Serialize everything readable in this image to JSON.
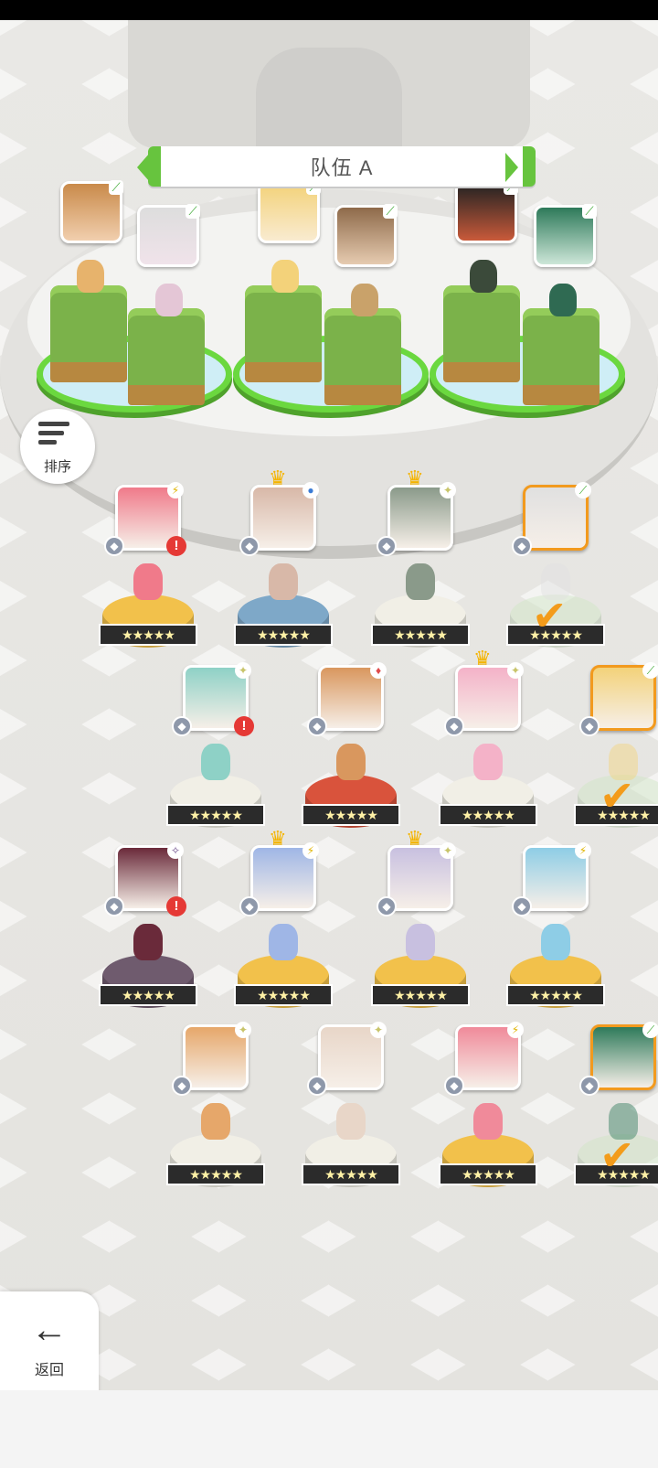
{
  "team": {
    "title": "队伍 A"
  },
  "sort": {
    "label": "排序",
    "icon": "sort-lines-icon"
  },
  "back": {
    "label": "返回",
    "icon": "arrow-left-icon"
  },
  "colors": {
    "accent_green": "#67c43e",
    "selected_orange": "#f29a1e",
    "alert_red": "#e53935",
    "crown_gold": "#f4b400"
  },
  "team_slots": [
    {
      "slot": 1,
      "element_icon": "leaf-icon"
    },
    {
      "slot": 2,
      "element_icon": "leaf-icon"
    },
    {
      "slot": 3,
      "element_icon": "leaf-icon"
    },
    {
      "slot": 4,
      "element_icon": "leaf-icon"
    },
    {
      "slot": 5,
      "element_icon": "leaf-icon"
    },
    {
      "slot": 6,
      "element_icon": "leaf-icon"
    }
  ],
  "roster": [
    {
      "element": "lightning",
      "stars": 5,
      "crown": false,
      "alert": true,
      "selected": false,
      "pedestal": "gold"
    },
    {
      "element": "water",
      "stars": 5,
      "crown": true,
      "alert": false,
      "selected": false,
      "pedestal": "blue"
    },
    {
      "element": "light",
      "stars": 5,
      "crown": true,
      "alert": false,
      "selected": false,
      "pedestal": "white"
    },
    {
      "element": "leaf",
      "stars": 5,
      "crown": false,
      "alert": false,
      "selected": true,
      "pedestal": "green"
    },
    {
      "element": "light",
      "stars": 5,
      "crown": false,
      "alert": true,
      "selected": false,
      "pedestal": "white"
    },
    {
      "element": "fire",
      "stars": 5,
      "crown": false,
      "alert": false,
      "selected": false,
      "pedestal": "red"
    },
    {
      "element": "light",
      "stars": 5,
      "crown": true,
      "alert": false,
      "selected": false,
      "pedestal": "white"
    },
    {
      "element": "leaf",
      "stars": 5,
      "crown": false,
      "alert": false,
      "selected": true,
      "pedestal": "green"
    },
    {
      "element": "dark",
      "stars": 5,
      "crown": false,
      "alert": true,
      "selected": false,
      "pedestal": "purple"
    },
    {
      "element": "lightning",
      "stars": 5,
      "crown": true,
      "alert": false,
      "selected": false,
      "pedestal": "gold"
    },
    {
      "element": "light",
      "stars": 5,
      "crown": true,
      "alert": false,
      "selected": false,
      "pedestal": "gold"
    },
    {
      "element": "lightning",
      "stars": 5,
      "crown": false,
      "alert": false,
      "selected": false,
      "pedestal": "gold"
    },
    {
      "element": "light",
      "stars": 5,
      "crown": false,
      "alert": false,
      "selected": false,
      "pedestal": "white"
    },
    {
      "element": "light",
      "stars": 5,
      "crown": false,
      "alert": false,
      "selected": false,
      "pedestal": "white"
    },
    {
      "element": "lightning",
      "stars": 5,
      "crown": false,
      "alert": false,
      "selected": false,
      "pedestal": "gold"
    },
    {
      "element": "leaf",
      "stars": 5,
      "crown": false,
      "alert": false,
      "selected": true,
      "pedestal": "green"
    }
  ]
}
